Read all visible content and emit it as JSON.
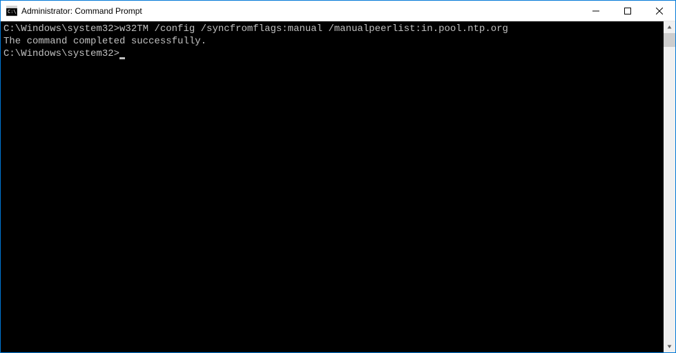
{
  "window": {
    "title": "Administrator: Command Prompt",
    "icon_name": "command-prompt-icon"
  },
  "terminal": {
    "lines": [
      {
        "prompt": "C:\\Windows\\system32>",
        "command": "w32TM /config /syncfromflags:manual /manualpeerlist:in.pool.ntp.org"
      },
      {
        "text": "The command completed successfully."
      },
      {
        "text": ""
      },
      {
        "prompt": "C:\\Windows\\system32>",
        "command": "",
        "cursor": true
      }
    ]
  },
  "titlebar_controls": {
    "minimize": "minimize",
    "maximize": "maximize",
    "close": "close"
  }
}
